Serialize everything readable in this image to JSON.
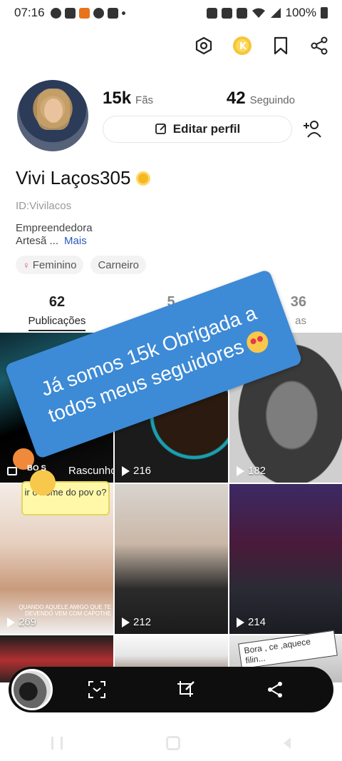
{
  "status_bar": {
    "time": "07:16",
    "battery_pct": "100%",
    "left_icons": [
      "whatsapp-icon",
      "message-icon",
      "app-icon",
      "facebook-icon",
      "youtube-icon",
      "dot-icon"
    ],
    "right_icons": [
      "alarm-icon",
      "vibrate-icon",
      "mute-icon",
      "wifi-icon",
      "signal-icon",
      "battery-icon"
    ]
  },
  "header_icons": [
    "settings-hex-icon",
    "coin-icon",
    "bookmark-icon",
    "share-icon"
  ],
  "profile": {
    "fans_count": "15k",
    "fans_label": "Fãs",
    "following_count": "42",
    "following_label": "Seguindo",
    "edit_label": "Editar perfil",
    "name": "Vivi Laços305",
    "id": "ID:Vivilacos",
    "bio_line1": "Empreendedora",
    "bio_line2": "Artesã ...",
    "more_label": "Mais",
    "tags": [
      "Feminino",
      "Carneiro"
    ]
  },
  "tabs": [
    {
      "count": "62",
      "label": "Publicações"
    },
    {
      "count": "5",
      "label": ""
    },
    {
      "count": "36",
      "label": "as"
    }
  ],
  "grid": {
    "draft_label": "Rascunho",
    "views": [
      "216",
      "182",
      "269",
      "212",
      "214"
    ],
    "bonus_label": "BO S",
    "bubble_text": "ir o nome do pov o?",
    "caption_text": "QUANDO AQUELE AMIGO QUE TE DEVENDO VEM COM CAPOTHE",
    "board_text": "Bora , ce ,aquece filin..."
  },
  "overlay_text": "Já somos 15k Obrigada a todos meus seguidores",
  "bottom_bar_icons": [
    "scan-icon",
    "crop-edit-icon",
    "share-icon"
  ]
}
